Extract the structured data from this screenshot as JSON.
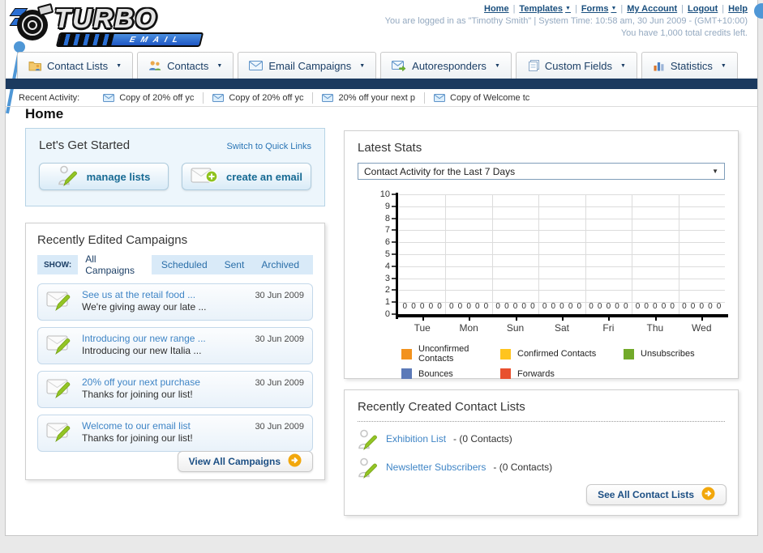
{
  "logo": {
    "title": "TURBO",
    "subtitle": "EMAIL"
  },
  "header": {
    "links": [
      {
        "label": "Home",
        "dropdown": false
      },
      {
        "label": "Templates",
        "dropdown": true
      },
      {
        "label": "Forms",
        "dropdown": true
      },
      {
        "label": "My Account",
        "dropdown": false
      },
      {
        "label": "Logout",
        "dropdown": false
      },
      {
        "label": "Help",
        "dropdown": false
      }
    ],
    "login_info": "You are logged in as \"Timothy Smith\" | System Time: 10:58 am, 30 Jun 2009 - (GMT+10:00)",
    "credits_info": "You have 1,000 total credits left."
  },
  "main_nav": {
    "tabs": [
      {
        "label": "Contact Lists",
        "icon": "folder-contact-icon"
      },
      {
        "label": "Contacts",
        "icon": "people-icon"
      },
      {
        "label": "Email Campaigns",
        "icon": "envelope-icon"
      },
      {
        "label": "Autoresponders",
        "icon": "envelope-arrow-icon"
      },
      {
        "label": "Custom Fields",
        "icon": "pages-icon"
      },
      {
        "label": "Statistics",
        "icon": "bar-chart-icon"
      }
    ]
  },
  "recent_activity": {
    "label": "Recent Activity:",
    "items": [
      "Copy of 20% off yc",
      "Copy of 20% off yc",
      "20% off your next p",
      "Copy of Welcome tc"
    ]
  },
  "page_title": "Home",
  "get_started": {
    "title": "Let's Get Started",
    "switch_link": "Switch to Quick Links",
    "buttons": [
      {
        "label": "manage lists",
        "icon": "person-pencil-icon"
      },
      {
        "label": "create an email",
        "icon": "envelope-plus-icon"
      }
    ]
  },
  "campaigns": {
    "title": "Recently Edited Campaigns",
    "show_label": "SHOW:",
    "tabs": [
      {
        "label": "All Campaigns",
        "active": true
      },
      {
        "label": "Scheduled",
        "active": false
      },
      {
        "label": "Sent",
        "active": false
      },
      {
        "label": "Archived",
        "active": false
      }
    ],
    "items": [
      {
        "title": "See us at the retail food ...",
        "subtitle": "We're giving away our late ...",
        "date": "30 Jun 2009"
      },
      {
        "title": "Introducing our new range ...",
        "subtitle": "Introducing our new Italia ...",
        "date": "30 Jun 2009"
      },
      {
        "title": "20% off your next purchase",
        "subtitle": "Thanks for joining our list!",
        "date": "30 Jun 2009"
      },
      {
        "title": "Welcome to our email list",
        "subtitle": "Thanks for joining our list!",
        "date": "30 Jun 2009"
      }
    ],
    "view_all_label": "View All Campaigns"
  },
  "latest_stats": {
    "title": "Latest Stats",
    "selected_option": "Contact Activity for the Last 7 Days"
  },
  "chart_data": {
    "type": "bar",
    "title": "Contact Activity for the Last 7 Days",
    "categories": [
      "Tue",
      "Mon",
      "Sun",
      "Sat",
      "Fri",
      "Thu",
      "Wed"
    ],
    "series": [
      {
        "name": "Unconfirmed Contacts",
        "color": "#F2921E",
        "values": [
          0,
          0,
          0,
          0,
          0,
          0,
          0
        ]
      },
      {
        "name": "Confirmed Contacts",
        "color": "#FFC41E",
        "values": [
          0,
          0,
          0,
          0,
          0,
          0,
          0
        ]
      },
      {
        "name": "Unsubscribes",
        "color": "#72AA2A",
        "values": [
          0,
          0,
          0,
          0,
          0,
          0,
          0
        ]
      },
      {
        "name": "Bounces",
        "color": "#5C7AB8",
        "values": [
          0,
          0,
          0,
          0,
          0,
          0,
          0
        ]
      },
      {
        "name": "Forwards",
        "color": "#E8502E",
        "values": [
          0,
          0,
          0,
          0,
          0,
          0,
          0
        ]
      }
    ],
    "xlabel": "",
    "ylabel": "",
    "ylim": [
      0,
      10
    ],
    "yticks": [
      0,
      1,
      2,
      3,
      4,
      5,
      6,
      7,
      8,
      9,
      10
    ],
    "grid": true,
    "legend_position": "bottom"
  },
  "contact_lists": {
    "title": "Recently Created Contact Lists",
    "items": [
      {
        "name": "Exhibition List",
        "detail": "- (0 Contacts)"
      },
      {
        "name": "Newsletter Subscribers",
        "detail": "- (0 Contacts)"
      }
    ],
    "see_all_label": "See All Contact Lists"
  },
  "colors": {
    "accent_blue": "#4f97d6",
    "navy_bar": "#1b3a5f",
    "link_blue": "#3f85c6",
    "button_text": "#176a93"
  }
}
